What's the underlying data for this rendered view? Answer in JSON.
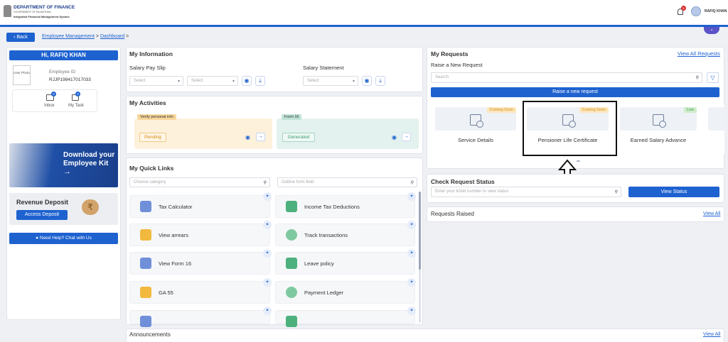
{
  "header": {
    "dept": "DEPARTMENT OF FINANCE",
    "sub1": "GOVERNMENT OF RAJASTHAN",
    "sub2": "Integrated Financial Management System",
    "notif_count": "5",
    "user": "RAFIQ KHAN"
  },
  "nav": {
    "back": "Back",
    "crumb1": "Employee Management",
    "crumb2": "Dashboard",
    "sep": ">"
  },
  "profile": {
    "greeting": "Hi, RAFIQ KHAN",
    "photo_text": "User Photo",
    "id_label": "Employee ID",
    "id_value": "RJJP198417017033",
    "inbox_label": "Inbox",
    "inbox_count": "0",
    "task_label": "My Task",
    "task_count": "0"
  },
  "kit": {
    "line1": "Download your",
    "line2": "Employee Kit",
    "arrow": "→"
  },
  "revenue": {
    "title": "Revenue Deposit",
    "button": "Access Deposit"
  },
  "help": {
    "label": "Need Help? Chat with Us"
  },
  "info": {
    "title": "My Information",
    "pay_slip": "Salary Pay Slip",
    "statement": "Salary Statement",
    "select": "Select"
  },
  "activities": {
    "title": "My Activities",
    "a1_tag": "Verify personal info",
    "a1_status": "Pending",
    "a2_tag": "Form 16",
    "a2_status": "Generated"
  },
  "quicklinks": {
    "title": "My Quick Links",
    "cat_placeholder": "Choose category",
    "form_placeholder": "Outline form field",
    "items": [
      "Tax Calculator",
      "Income Tax Deductions",
      "View arrears",
      "Track transactions",
      "View Form 16",
      "Leave policy",
      "GA 55",
      "Payment Ledger"
    ]
  },
  "requests": {
    "title": "My Requests",
    "view_all": "View All Requests",
    "raise": "Raise a New Request",
    "search": "Search",
    "raise_btn": "Raise a new request",
    "cards": [
      {
        "label": "Service Details",
        "badge": "Coming Soon"
      },
      {
        "label": "Pensioner Life Certificate",
        "badge": "Coming Soon"
      },
      {
        "label": "Earned Salary Advance",
        "badge": "Live"
      }
    ]
  },
  "status": {
    "title": "Check Request Status",
    "placeholder": "Enter your ticket number to view status",
    "button": "View Status"
  },
  "raised": {
    "title": "Requests Raised",
    "view_all": "View All"
  },
  "announcements": {
    "title": "Announcements",
    "view_all": "View All"
  },
  "colors": {
    "primary": "#1e62d0",
    "nav_dark": "#1b3f8c",
    "coming": "#f2a31b",
    "live": "#3a9a4a"
  }
}
